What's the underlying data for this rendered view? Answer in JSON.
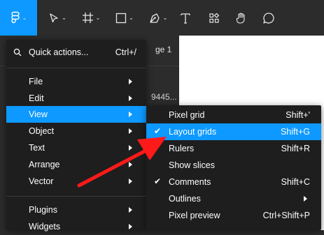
{
  "background": {
    "page_label": "ge 1",
    "fragment": "9445..."
  },
  "main_menu": {
    "quick_actions": {
      "label": "Quick actions...",
      "shortcut": "Ctrl+/"
    },
    "items": [
      {
        "label": "File"
      },
      {
        "label": "Edit"
      },
      {
        "label": "View"
      },
      {
        "label": "Object"
      },
      {
        "label": "Text"
      },
      {
        "label": "Arrange"
      },
      {
        "label": "Vector"
      },
      {
        "label": "Plugins"
      },
      {
        "label": "Widgets"
      }
    ]
  },
  "view_submenu": {
    "items": [
      {
        "label": "Pixel grid",
        "shortcut": "Shift+'"
      },
      {
        "label": "Layout grids",
        "shortcut": "Shift+G",
        "checked": true
      },
      {
        "label": "Rulers",
        "shortcut": "Shift+R"
      },
      {
        "label": "Show slices",
        "shortcut": ""
      },
      {
        "label": "Comments",
        "shortcut": "Shift+C",
        "checked": true
      },
      {
        "label": "Outlines",
        "shortcut": ""
      },
      {
        "label": "Pixel preview",
        "shortcut": "Ctrl+Shift+P"
      }
    ]
  },
  "colors": {
    "accent": "#0d99ff",
    "menu_bg": "#1e1e1e",
    "toolbar_bg": "#2c2c2c",
    "annotation": "#ff1a1a"
  },
  "icons": [
    "figma-logo-icon",
    "move-tool-icon",
    "frame-tool-icon",
    "shape-tool-icon",
    "pen-tool-icon",
    "text-tool-icon",
    "resources-icon",
    "hand-tool-icon",
    "comment-icon",
    "search-icon",
    "check-icon",
    "chevron-right-icon"
  ]
}
